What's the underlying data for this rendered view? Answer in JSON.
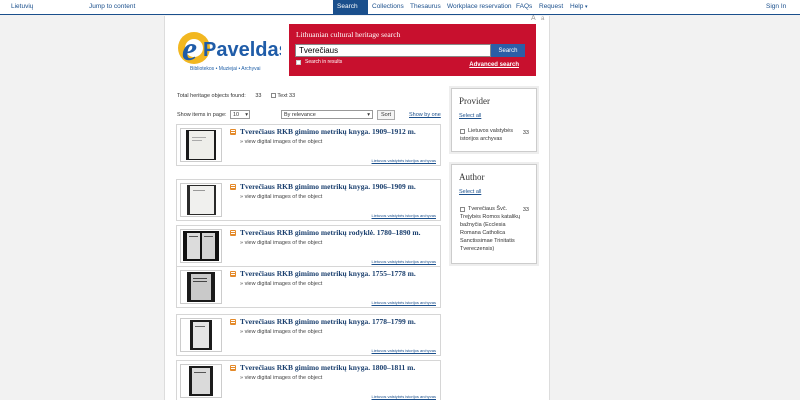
{
  "topbar": {
    "language": "Lietuvių",
    "skip": "Jump to content",
    "nav": [
      "Search",
      "Collections",
      "Thesaurus",
      "Workplace reservation",
      "FAQs",
      "Request",
      "Help"
    ],
    "help_caret": "▾",
    "signin": "Sign In"
  },
  "font_size": {
    "larger": "A",
    "smaller": "a"
  },
  "logo": {
    "letter": "e",
    "word": "Paveldas",
    "subtitle": "Bibliotekos • Muziejai • Archyvai"
  },
  "search": {
    "title": "Lithuanian cultural heritage search",
    "query": "Tverečiaus",
    "button": "Search",
    "in_results": "Search in results",
    "advanced": "Advanced search"
  },
  "summary": {
    "found_label": "Total heritage objects found:",
    "found_count": "33",
    "text_label": "Text 33"
  },
  "controls": {
    "show_items_label": "Show items in page:",
    "per_page": "10",
    "sort_by": "By relevance",
    "sort_button": "Sort",
    "show_by_one": "Show by one",
    "caret": "▾"
  },
  "results": [
    {
      "title": "Tverečiaus RKB gimimo metrikų knyga. 1909–1912 m.",
      "link": "» view digital images of the object",
      "source": "Lietuvos valstybės istorijos archyvas"
    },
    {
      "title": "Tverečiaus RKB gimimo metrikų knyga. 1906–1909 m.",
      "link": "» view digital images of the object",
      "source": "Lietuvos valstybės istorijos archyvas"
    },
    {
      "title": "Tverečiaus RKB gimimo metrikų rodyklė. 1780–1890 m.",
      "link": "» view digital images of the object",
      "source": "Lietuvos valstybės istorijos archyvas"
    },
    {
      "title": "Tverečiaus RKB gimimo metrikų knyga. 1755–1778 m.",
      "link": "» view digital images of the object",
      "source": "Lietuvos valstybės istorijos archyvas"
    },
    {
      "title": "Tverečiaus RKB gimimo metrikų knyga. 1778–1799 m.",
      "link": "» view digital images of the object",
      "source": "Lietuvos valstybės istorijos archyvas"
    },
    {
      "title": "Tverečiaus RKB gimimo metrikų knyga. 1800–1811 m.",
      "link": "» view digital images of the object",
      "source": "Lietuvos valstybės istorijos archyvas"
    }
  ],
  "facets": {
    "provider": {
      "heading": "Provider",
      "select_all": "Select all",
      "items": [
        {
          "label": "Lietuvos valstybės istorijos archyvas",
          "count": "33"
        }
      ]
    },
    "author": {
      "heading": "Author",
      "select_all": "Select all",
      "items": [
        {
          "label": "Tverečiaus Švč. Trejybės Romos katalikų bažnyčia (Ecclesia Romana Catholica Sanctissimae Trinitatis Tvereczensis)",
          "count": "33"
        }
      ]
    }
  },
  "colors": {
    "brand_red": "#c8102e",
    "brand_blue": "#1a4f8c"
  }
}
